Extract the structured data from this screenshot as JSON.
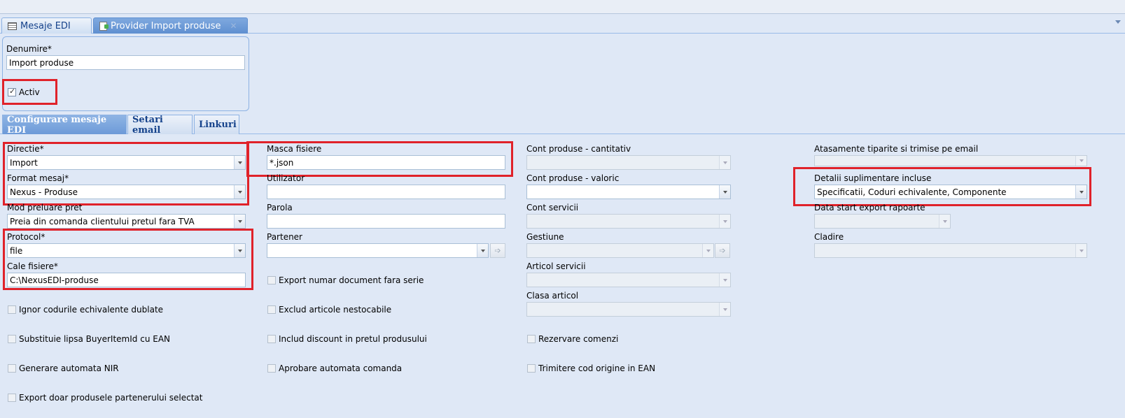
{
  "tabs": [
    {
      "label": "Mesaje EDI"
    },
    {
      "label": "Provider Import produse"
    }
  ],
  "header": {
    "denumire_label": "Denumire*",
    "denumire_value": "Import produse",
    "activ_label": "Activ",
    "activ_checked": true
  },
  "subtabs": [
    "Configurare mesaje EDI",
    "Setari email",
    "Linkuri"
  ],
  "col1": {
    "directie_label": "Directie*",
    "directie_value": "Import",
    "format_label": "Format mesaj*",
    "format_value": "Nexus - Produse",
    "mod_label": "Mod preluare pret",
    "mod_value": "Preia din comanda clientului pretul fara TVA",
    "protocol_label": "Protocol*",
    "protocol_value": "file",
    "cale_label": "Cale fisiere*",
    "cale_value": "C:\\NexusEDI-produse",
    "cb1": "Ignor codurile echivalente dublate",
    "cb2": "Substituie lipsa BuyerItemId cu EAN",
    "cb3": "Generare automata NIR",
    "cb4": "Export doar produsele partenerului selectat"
  },
  "col2": {
    "masca_label": "Masca fisiere",
    "masca_value": "*.json",
    "utilizator_label": "Utilizator",
    "utilizator_value": "",
    "parola_label": "Parola",
    "parola_value": "",
    "partener_label": "Partener",
    "partener_value": "",
    "cb1": "Export numar document fara serie",
    "cb2": "Exclud articole nestocabile",
    "cb3": "Includ discount in pretul produsului",
    "cb4": "Aprobare automata comanda"
  },
  "col3": {
    "cant_label": "Cont produse - cantitativ",
    "val_label": "Cont produse - valoric",
    "serv_label": "Cont servicii",
    "gest_label": "Gestiune",
    "art_label": "Articol servicii",
    "clasa_label": "Clasa articol",
    "cb1": "Rezervare comenzi",
    "cb2": "Trimitere cod origine in EAN"
  },
  "col4": {
    "atas_label": "Atasamente tiparite si trimise pe email",
    "det_label": "Detalii suplimentare incluse",
    "det_value": "Specificatii, Coduri echivalente, Componente",
    "data_label": "Data start export rapoarte",
    "cladire_label": "Cladire"
  },
  "colors": {
    "highlight": "#e0222a",
    "background": "#dfe8f6",
    "tab_active": "#6c9ad8"
  }
}
